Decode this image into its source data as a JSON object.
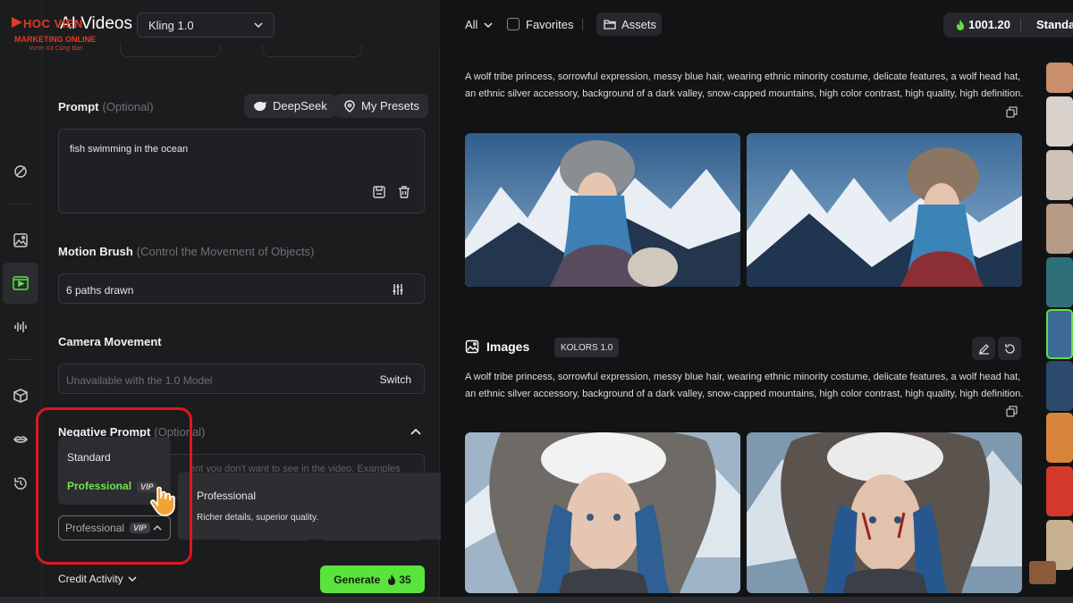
{
  "logo": {
    "brand": "HOC VIEN",
    "line2": "MARKETING ONLINE",
    "line3": "Vươn Xa Cùng Bạn"
  },
  "header": {
    "title": "AI Videos",
    "model": "Kling 1.0"
  },
  "prompt": {
    "label": "Prompt",
    "optional": "(Optional)",
    "deepseek_label": "DeepSeek",
    "presets_label": "My Presets",
    "value": "fish swimming in the ocean"
  },
  "motion_brush": {
    "label": "Motion Brush",
    "hint": "(Control the Movement of Objects)",
    "value": "6 paths drawn"
  },
  "camera": {
    "label": "Camera Movement",
    "placeholder": "Unavailable with the 1.0 Model",
    "action": "Switch"
  },
  "negative_prompt": {
    "label": "Negative Prompt",
    "optional": "(Optional)",
    "hint": "ent you don't want to see in the video. Examples"
  },
  "mode_dropdown": {
    "options": [
      {
        "label": "Standard"
      },
      {
        "label": "Professional",
        "badge": "VIP"
      }
    ],
    "selected": "Professional",
    "selected_badge": "VIP"
  },
  "tooltip": {
    "title": "Professional",
    "description": "Richer details, superior quality."
  },
  "footer": {
    "credit_activity": "Credit Activity",
    "generate_label": "Generate",
    "generate_cost": "35"
  },
  "toolbar": {
    "filter_all": "All",
    "favorites": "Favorites",
    "assets": "Assets",
    "credits": "1001.20",
    "plan": "Standard"
  },
  "results": [
    {
      "description": "A wolf tribe princess, sorrowful expression, messy blue hair, wearing ethnic minority costume, delicate features, a wolf head hat, an ethnic silver accessory, background of a dark valley, snow-capped mountains, high color contrast, high quality, high definition."
    },
    {
      "section": "Images",
      "model_tag": "KOLORS 1.0",
      "description": "A wolf tribe princess, sorrowful expression, messy blue hair, wearing ethnic minority costume, delicate features, a wolf head hat, an ethnic silver accessory, background of a dark valley, snow-capped mountains, high color contrast, high quality, high definition."
    }
  ],
  "colors": {
    "accent": "#5be33d",
    "highlight": "#e1151c",
    "background": "#121314",
    "panel": "#1b1c1e"
  }
}
